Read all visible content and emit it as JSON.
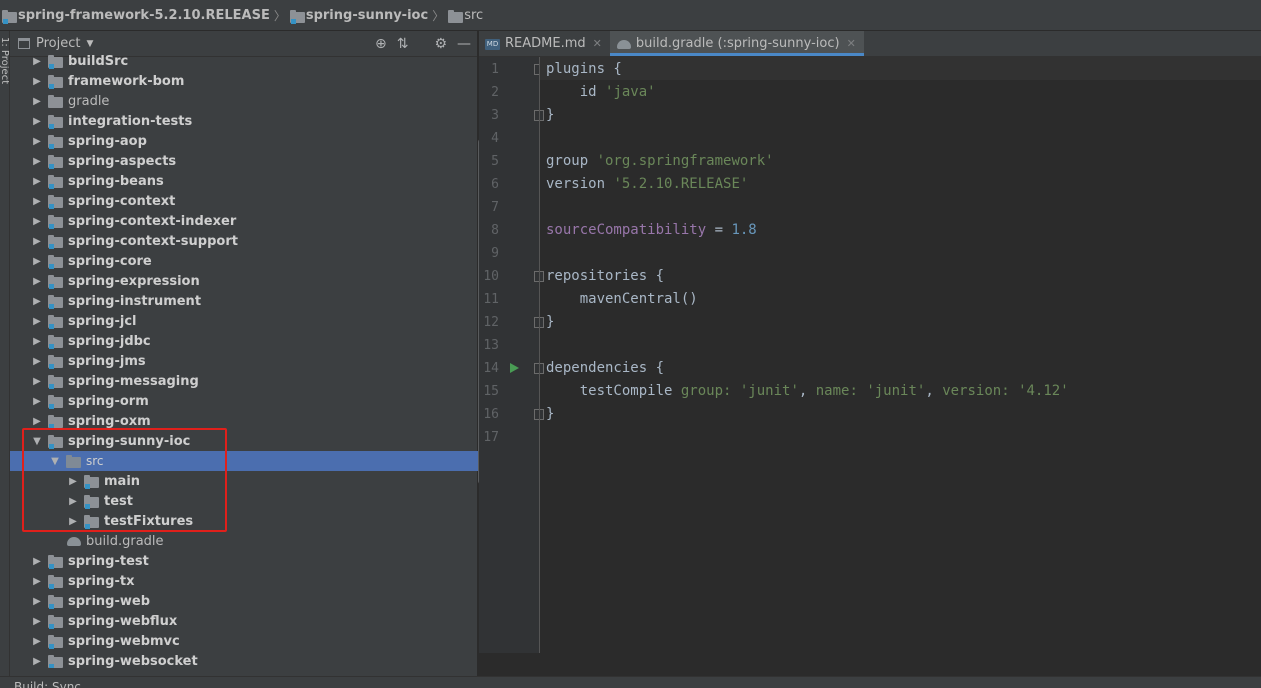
{
  "breadcrumb": [
    "spring-framework-5.2.10.RELEASE",
    "spring-sunny-ioc",
    "src"
  ],
  "stripe_label": "1: Project",
  "project_panel": {
    "title": "Project",
    "tools": [
      "target-icon",
      "collapse-icon",
      "gear-icon",
      "minimize-icon"
    ]
  },
  "tree": [
    {
      "label": "buildSrc",
      "depth": 0,
      "expanded": false,
      "icon": "module-folder",
      "bold": true
    },
    {
      "label": "framework-bom",
      "depth": 0,
      "expanded": false,
      "icon": "module-folder",
      "bold": true
    },
    {
      "label": "gradle",
      "depth": 0,
      "expanded": false,
      "icon": "folder",
      "bold": false
    },
    {
      "label": "integration-tests",
      "depth": 0,
      "expanded": false,
      "icon": "module-folder",
      "bold": true
    },
    {
      "label": "spring-aop",
      "depth": 0,
      "expanded": false,
      "icon": "module-folder",
      "bold": true
    },
    {
      "label": "spring-aspects",
      "depth": 0,
      "expanded": false,
      "icon": "module-folder",
      "bold": true
    },
    {
      "label": "spring-beans",
      "depth": 0,
      "expanded": false,
      "icon": "module-folder",
      "bold": true
    },
    {
      "label": "spring-context",
      "depth": 0,
      "expanded": false,
      "icon": "module-folder",
      "bold": true
    },
    {
      "label": "spring-context-indexer",
      "depth": 0,
      "expanded": false,
      "icon": "module-folder",
      "bold": true
    },
    {
      "label": "spring-context-support",
      "depth": 0,
      "expanded": false,
      "icon": "module-folder",
      "bold": true
    },
    {
      "label": "spring-core",
      "depth": 0,
      "expanded": false,
      "icon": "module-folder",
      "bold": true
    },
    {
      "label": "spring-expression",
      "depth": 0,
      "expanded": false,
      "icon": "module-folder",
      "bold": true
    },
    {
      "label": "spring-instrument",
      "depth": 0,
      "expanded": false,
      "icon": "module-folder",
      "bold": true
    },
    {
      "label": "spring-jcl",
      "depth": 0,
      "expanded": false,
      "icon": "module-folder",
      "bold": true
    },
    {
      "label": "spring-jdbc",
      "depth": 0,
      "expanded": false,
      "icon": "module-folder",
      "bold": true
    },
    {
      "label": "spring-jms",
      "depth": 0,
      "expanded": false,
      "icon": "module-folder",
      "bold": true
    },
    {
      "label": "spring-messaging",
      "depth": 0,
      "expanded": false,
      "icon": "module-folder",
      "bold": true
    },
    {
      "label": "spring-orm",
      "depth": 0,
      "expanded": false,
      "icon": "module-folder",
      "bold": true
    },
    {
      "label": "spring-oxm",
      "depth": 0,
      "expanded": false,
      "icon": "module-folder",
      "bold": true
    },
    {
      "label": "spring-sunny-ioc",
      "depth": 0,
      "expanded": true,
      "icon": "module-folder",
      "bold": true
    },
    {
      "label": "src",
      "depth": 1,
      "expanded": true,
      "icon": "folder",
      "bold": false,
      "selected": true
    },
    {
      "label": "main",
      "depth": 2,
      "expanded": false,
      "icon": "module-folder",
      "bold": true
    },
    {
      "label": "test",
      "depth": 2,
      "expanded": false,
      "icon": "module-folder",
      "bold": true
    },
    {
      "label": "testFixtures",
      "depth": 2,
      "expanded": false,
      "icon": "module-folder",
      "bold": true
    },
    {
      "label": "build.gradle",
      "depth": 1,
      "expanded": null,
      "icon": "gradle",
      "bold": false
    },
    {
      "label": "spring-test",
      "depth": 0,
      "expanded": false,
      "icon": "module-folder",
      "bold": true
    },
    {
      "label": "spring-tx",
      "depth": 0,
      "expanded": false,
      "icon": "module-folder",
      "bold": true
    },
    {
      "label": "spring-web",
      "depth": 0,
      "expanded": false,
      "icon": "module-folder",
      "bold": true
    },
    {
      "label": "spring-webflux",
      "depth": 0,
      "expanded": false,
      "icon": "module-folder",
      "bold": true
    },
    {
      "label": "spring-webmvc",
      "depth": 0,
      "expanded": false,
      "icon": "module-folder",
      "bold": true
    },
    {
      "label": "spring-websocket",
      "depth": 0,
      "expanded": false,
      "icon": "module-folder",
      "bold": true
    }
  ],
  "tabs": [
    {
      "label": "README.md",
      "icon": "markdown-icon",
      "active": false
    },
    {
      "label": "build.gradle (:spring-sunny-ioc)",
      "icon": "gradle-icon",
      "active": true
    }
  ],
  "code_lines": [
    [
      {
        "t": "plugins {",
        "c": "nm"
      }
    ],
    [
      {
        "t": "    id ",
        "c": "nm"
      },
      {
        "t": "'java'",
        "c": "str"
      }
    ],
    [
      {
        "t": "}",
        "c": "nm"
      }
    ],
    [],
    [
      {
        "t": "group ",
        "c": "nm"
      },
      {
        "t": "'org.springframework'",
        "c": "str"
      }
    ],
    [
      {
        "t": "version ",
        "c": "nm"
      },
      {
        "t": "'5.2.10.RELEASE'",
        "c": "str"
      }
    ],
    [],
    [
      {
        "t": "sourceCompatibility",
        "c": "fld"
      },
      {
        "t": " = ",
        "c": "nm"
      },
      {
        "t": "1.8",
        "c": "num"
      }
    ],
    [],
    [
      {
        "t": "repositories {",
        "c": "nm"
      }
    ],
    [
      {
        "t": "    mavenCentral()",
        "c": "nm"
      }
    ],
    [
      {
        "t": "}",
        "c": "nm"
      }
    ],
    [],
    [
      {
        "t": "dependencies {",
        "c": "nm"
      }
    ],
    [
      {
        "t": "    testCompile ",
        "c": "nm"
      },
      {
        "t": "group: ",
        "c": "str"
      },
      {
        "t": "'junit'",
        "c": "str"
      },
      {
        "t": ", ",
        "c": "nm"
      },
      {
        "t": "name: ",
        "c": "str"
      },
      {
        "t": "'junit'",
        "c": "str"
      },
      {
        "t": ", ",
        "c": "nm"
      },
      {
        "t": "version: ",
        "c": "str"
      },
      {
        "t": "'4.12'",
        "c": "str"
      }
    ],
    [
      {
        "t": "}",
        "c": "nm"
      }
    ],
    []
  ],
  "run_line": 14,
  "fold_lines": [
    1,
    3,
    10,
    12,
    14,
    16
  ],
  "status": "Build: Sync",
  "colors": {
    "selection": "#4b6eaf",
    "highlight_box": "#e0201b",
    "string": "#6a8759",
    "field": "#9876aa",
    "number": "#6897bb"
  }
}
